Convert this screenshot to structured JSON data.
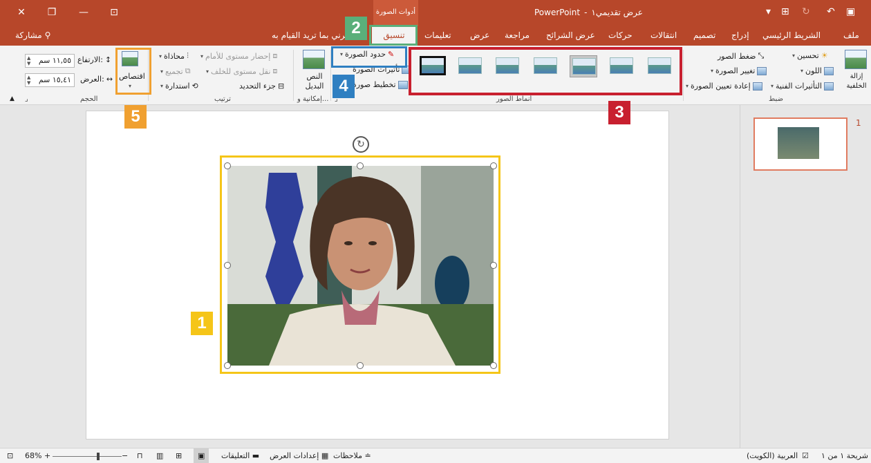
{
  "titlebar": {
    "app": "PowerPoint",
    "doc": "عرض تقديمي١",
    "separator": "-",
    "context_tab": "أدوات الصورة"
  },
  "tabs": {
    "file": "ملف",
    "home": "الشريط الرئيسي",
    "insert": "إدراج",
    "design": "تصميم",
    "transitions": "انتقالات",
    "animations": "حركات",
    "slideshow": "عرض الشرائح",
    "review": "مراجعة",
    "view": "عرض",
    "help": "تعليمات",
    "format": "تنسيق",
    "tellme": "أخبرني بما تريد القيام به",
    "share": "مشاركة"
  },
  "ribbon": {
    "adjust": {
      "label": "ضبط",
      "remove_bg": "إزالة الخلفية",
      "corrections": "تحسين",
      "color": "اللون",
      "artistic": "التأثيرات الفنية",
      "compress": "ضغط الصور",
      "change": "تغيير الصورة",
      "reset": "إعادة تعيين الصورة"
    },
    "styles": {
      "label": "أنماط الصور"
    },
    "picture": {
      "border": "حدود الصورة",
      "effects": "تأثيرات الصورة",
      "layout": "تخطيط صورة"
    },
    "accessibility": {
      "label": "إمكانية و...",
      "alt_text": "النص البديل"
    },
    "arrange": {
      "label": "ترتيب",
      "bring_forward": "إحضار مستوى للأمام",
      "send_backward": "نقل مستوى للخلف",
      "selection_pane": "جزء التحديد",
      "align": "محاذاة",
      "group": "تجميع",
      "rotate": "استدارة"
    },
    "size": {
      "label": "الحجم",
      "crop": "اقتصاص",
      "height_label": "الارتفاع:",
      "height_value": "١١,٥٥ سم",
      "width_label": "العرض:",
      "width_value": "١٥,٤١ سم"
    }
  },
  "callouts": {
    "c1": "1",
    "c2": "2",
    "c3": "3",
    "c4": "4",
    "c5": "5"
  },
  "thumbs": {
    "slide_number": "1"
  },
  "status": {
    "slide_info": "شريحة ١ من ١",
    "language": "العربية (الكويت)",
    "notes": "ملاحظات",
    "display_settings": "إعدادات العرض",
    "comments": "التعليقات",
    "zoom": "68%",
    "minus": "−",
    "plus": "+"
  },
  "colors": {
    "brand": "#b7472a",
    "callout_yellow": "#f5c518",
    "callout_green": "#5aaf7a",
    "callout_red": "#c8202f",
    "callout_blue": "#2f7fc1",
    "callout_orange": "#f0a030"
  }
}
